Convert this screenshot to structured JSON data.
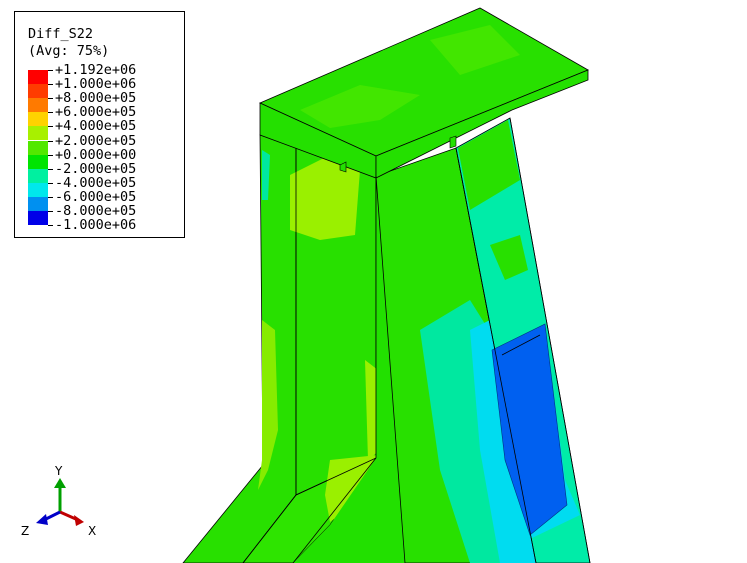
{
  "legend": {
    "variable": "Diff_S22",
    "averaging": "(Avg: 75%)",
    "entries": [
      {
        "label": "+1.192e+06",
        "color": "#ff0000"
      },
      {
        "label": "+1.000e+06",
        "color": "#ff3c00"
      },
      {
        "label": "+8.000e+05",
        "color": "#ff7a00"
      },
      {
        "label": "+6.000e+05",
        "color": "#ffd200"
      },
      {
        "label": "+4.000e+05",
        "color": "#a8f000"
      },
      {
        "label": "+2.000e+05",
        "color": "#52e800"
      },
      {
        "label": "+0.000e+00",
        "color": "#00e400"
      },
      {
        "label": "-2.000e+05",
        "color": "#00f0a0"
      },
      {
        "label": "-4.000e+05",
        "color": "#00e8ec"
      },
      {
        "label": "-6.000e+05",
        "color": "#0090f0"
      },
      {
        "label": "-8.000e+05",
        "color": "#0044f0"
      },
      {
        "label": "-1.000e+06",
        "color": "#0000e8"
      }
    ]
  },
  "triad": {
    "x": "X",
    "y": "Y",
    "z": "Z"
  },
  "colors": {
    "x_axis": "#c00000",
    "y_axis": "#00a000",
    "z_axis": "#0000c8"
  }
}
